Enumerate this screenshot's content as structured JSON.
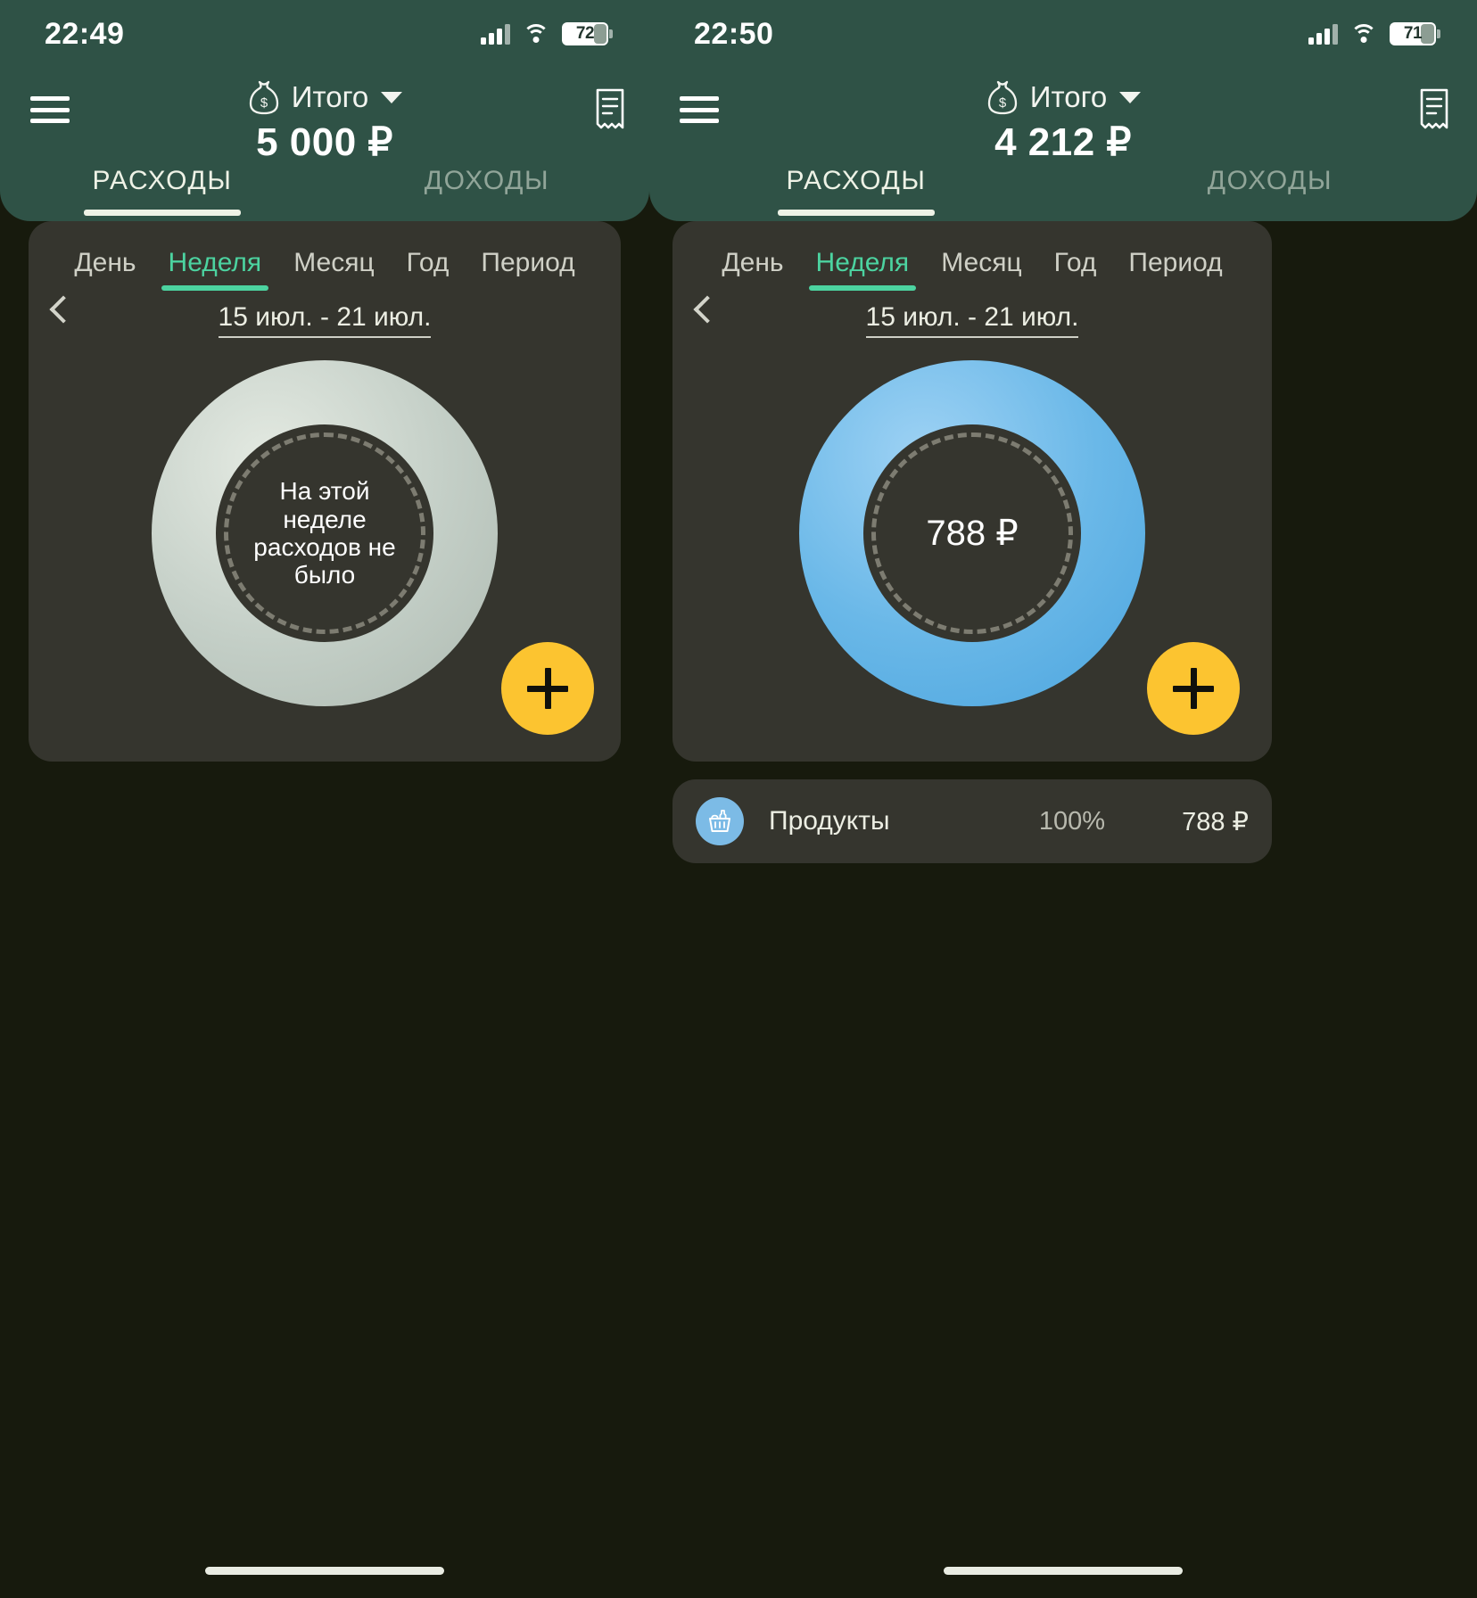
{
  "theme": {
    "header_green": "#2f5246",
    "card_dark": "#35352e",
    "page_bg": "#171a0d",
    "accent_teal": "#4cd3a0",
    "fab_yellow": "#fcc430",
    "donut_blue": "#6ab8e8",
    "donut_gray": "#c3cec6"
  },
  "screens": [
    {
      "id": "left",
      "statusbar": {
        "time": "22:49",
        "battery_level": "72",
        "signal_icon": "cellular-signal-icon",
        "wifi_icon": "wifi-icon",
        "battery_icon": "battery-icon"
      },
      "appbar": {
        "menu_icon": "hamburger-menu-icon",
        "receipt_icon": "receipt-icon",
        "account_icon": "money-bag-icon",
        "account_label": "Итого",
        "dropdown_icon": "chevron-down-icon",
        "total_amount": "5 000 ₽"
      },
      "main_tabs": [
        {
          "label": "РАСХОДЫ",
          "active": true
        },
        {
          "label": "ДОХОДЫ",
          "active": false
        }
      ],
      "period_tabs": [
        {
          "label": "День",
          "active": false
        },
        {
          "label": "Неделя",
          "active": true
        },
        {
          "label": "Месяц",
          "active": false
        },
        {
          "label": "Год",
          "active": false
        },
        {
          "label": "Период",
          "active": false
        }
      ],
      "date_nav": {
        "prev_icon": "chevron-left-icon",
        "range": "15 июл. - 21 июл."
      },
      "donut": {
        "state": "empty",
        "center_text": "На этой неделе расходов не было"
      },
      "fab": {
        "icon": "plus-icon",
        "label": "+"
      },
      "categories": []
    },
    {
      "id": "right",
      "statusbar": {
        "time": "22:50",
        "battery_level": "71",
        "signal_icon": "cellular-signal-icon",
        "wifi_icon": "wifi-icon",
        "battery_icon": "battery-icon"
      },
      "appbar": {
        "menu_icon": "hamburger-menu-icon",
        "receipt_icon": "receipt-icon",
        "account_icon": "money-bag-icon",
        "account_label": "Итого",
        "dropdown_icon": "chevron-down-icon",
        "total_amount": "4 212 ₽"
      },
      "main_tabs": [
        {
          "label": "РАСХОДЫ",
          "active": true
        },
        {
          "label": "ДОХОДЫ",
          "active": false
        }
      ],
      "period_tabs": [
        {
          "label": "День",
          "active": false
        },
        {
          "label": "Неделя",
          "active": true
        },
        {
          "label": "Месяц",
          "active": false
        },
        {
          "label": "Год",
          "active": false
        },
        {
          "label": "Период",
          "active": false
        }
      ],
      "date_nav": {
        "prev_icon": "chevron-left-icon",
        "range": "15 июл. - 21 июл."
      },
      "donut": {
        "state": "filled",
        "center_text": "788 ₽"
      },
      "fab": {
        "icon": "plus-icon",
        "label": "+"
      },
      "categories": [
        {
          "icon": "grocery-basket-icon",
          "name": "Продукты",
          "percent": "100%",
          "amount": "788 ₽",
          "color": "#7cbbe6"
        }
      ]
    }
  ],
  "chart_data": [
    {
      "type": "pie",
      "title": "Расходы — Неделя 15 июл. - 21 июл. (экран 1)",
      "categories": [],
      "values": [],
      "total": 0,
      "total_label": "На этой неделе расходов не было",
      "legend_position": "none"
    },
    {
      "type": "pie",
      "title": "Расходы — Неделя 15 июл. - 21 июл. (экран 2)",
      "categories": [
        "Продукты"
      ],
      "values": [
        788
      ],
      "percentages": [
        100
      ],
      "colors": [
        "#6ab8e8"
      ],
      "total": 788,
      "total_label": "788 ₽",
      "legend_position": "below"
    }
  ]
}
